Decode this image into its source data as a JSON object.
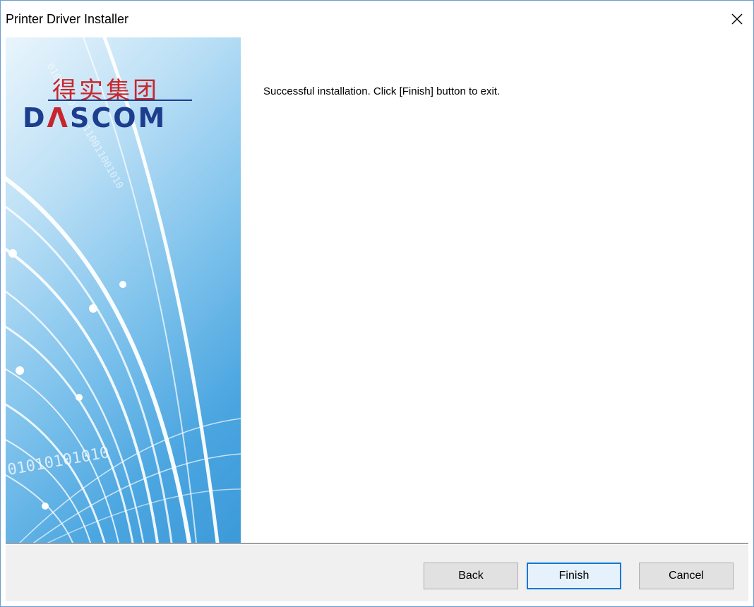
{
  "window": {
    "title": "Printer Driver Installer",
    "close_icon": "close-icon"
  },
  "banner": {
    "logo_chinese": "得实集团",
    "logo_english_prefix": "D",
    "logo_english_accent": "Λ",
    "logo_english_suffix": "SCOM",
    "binary_text_top": "010011001010110011001010",
    "binary_text_bottom": "01010101010"
  },
  "content": {
    "message": "Successful installation. Click [Finish] button to exit."
  },
  "footer": {
    "back_label": "Back",
    "finish_label": "Finish",
    "cancel_label": "Cancel"
  },
  "colors": {
    "accent": "#0078d7",
    "brand_blue": "#1d3d8f",
    "brand_red": "#c8262d"
  }
}
